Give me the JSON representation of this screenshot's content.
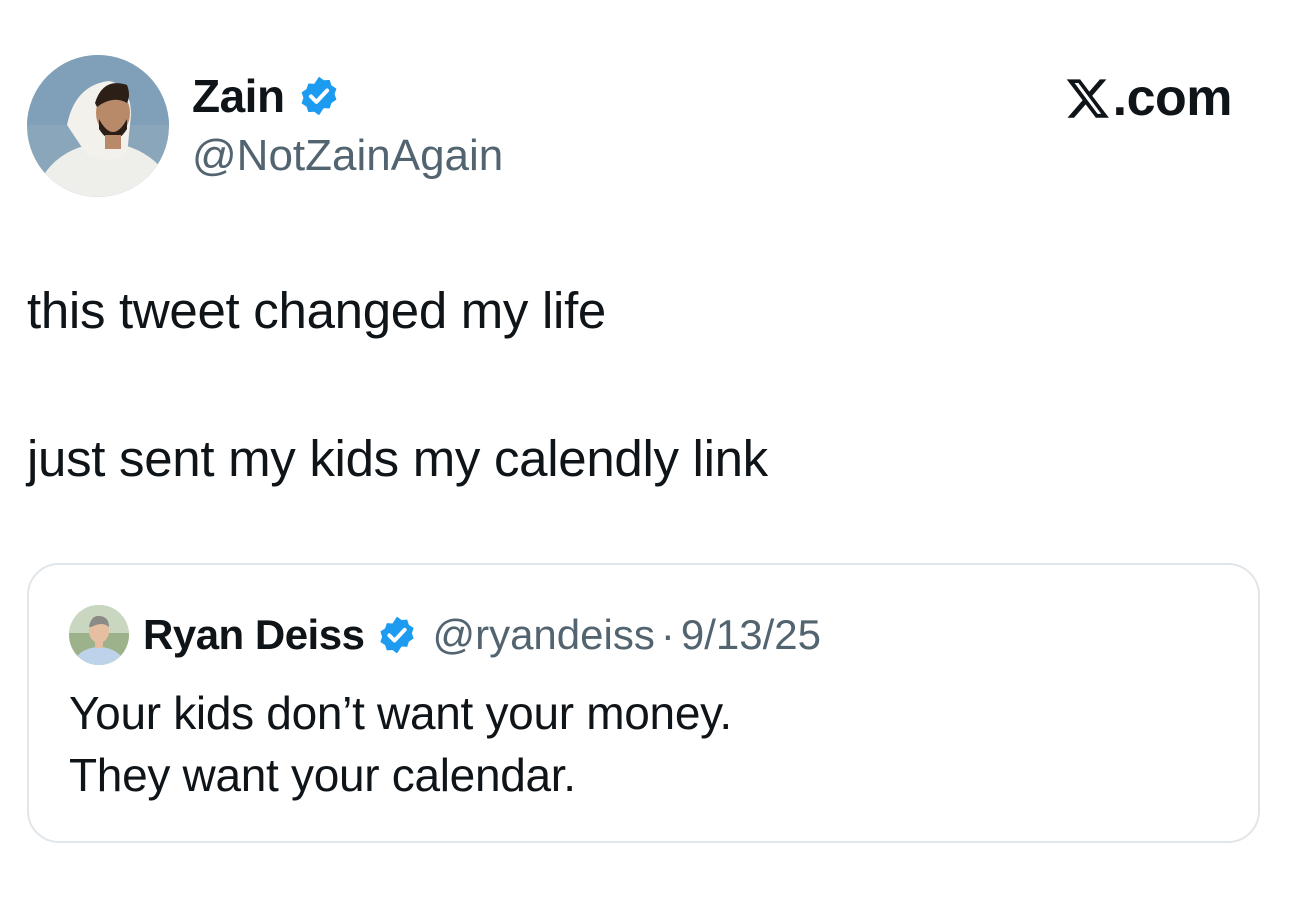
{
  "author": {
    "name": "Zain",
    "handle": "@NotZainAgain",
    "avatar_icon": "profile-photo",
    "verified_icon": "verified-badge-icon"
  },
  "brand": {
    "label": ".com",
    "logo_icon": "x-logo-icon"
  },
  "tweet": {
    "lines": [
      "this tweet changed my life",
      "just sent my kids my calendly link"
    ]
  },
  "quoted_tweet": {
    "name": "Ryan Deiss",
    "handle": "@ryandeiss",
    "separator": "·",
    "date": "9/13/25",
    "lines": [
      "Your kids don’t want your money.",
      "They want your calendar."
    ],
    "avatar_icon": "profile-photo",
    "verified_icon": "verified-badge-icon"
  },
  "colors": {
    "text": "#0f1419",
    "secondary_text": "#536471",
    "verified_blue": "#1d9bf0",
    "card_border": "#e1e6ea"
  }
}
